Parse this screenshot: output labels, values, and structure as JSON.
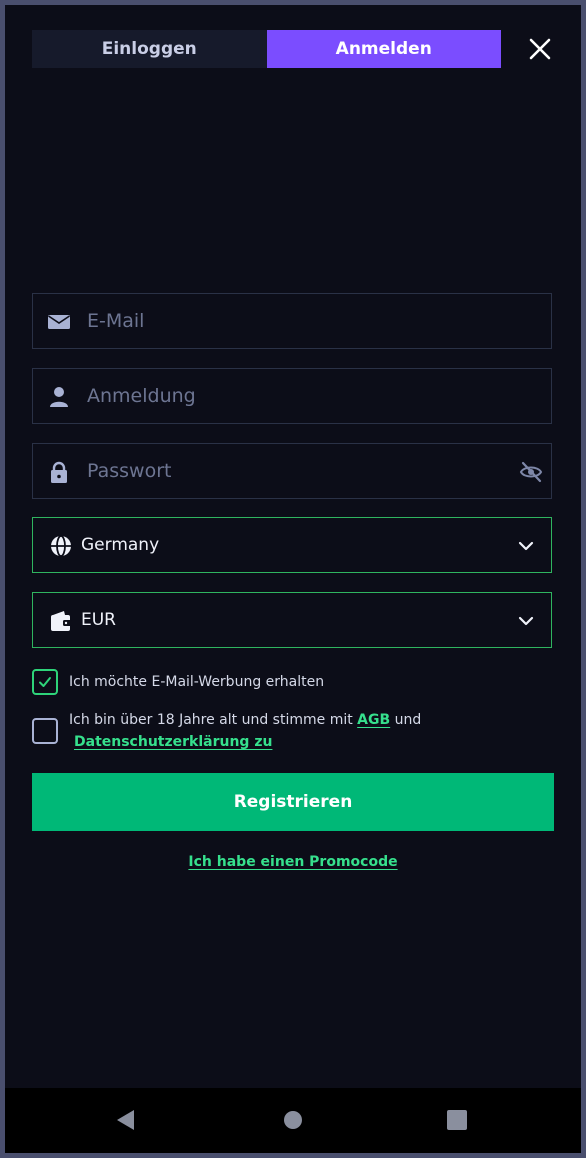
{
  "tabs": {
    "login": "Einloggen",
    "register": "Anmelden"
  },
  "form": {
    "email_placeholder": "E-Mail",
    "username_placeholder": "Anmeldung",
    "password_placeholder": "Passwort",
    "country": "Germany",
    "currency": "EUR"
  },
  "consent": {
    "email_ads": "Ich möchte E-Mail-Werbung erhalten",
    "email_ads_checked": true,
    "age_text": "Ich bin über 18 Jahre alt und stimme mit",
    "agb": "AGB",
    "and": "und",
    "privacy": "Datenschutzerklärung zu",
    "age_checked": false
  },
  "register_button": "Registrieren",
  "promo_link": "Ich habe einen Promocode",
  "colors": {
    "accent_purple": "#7b4dff",
    "accent_green": "#00b877",
    "link_green": "#36e08d",
    "background": "#0c0d18"
  }
}
